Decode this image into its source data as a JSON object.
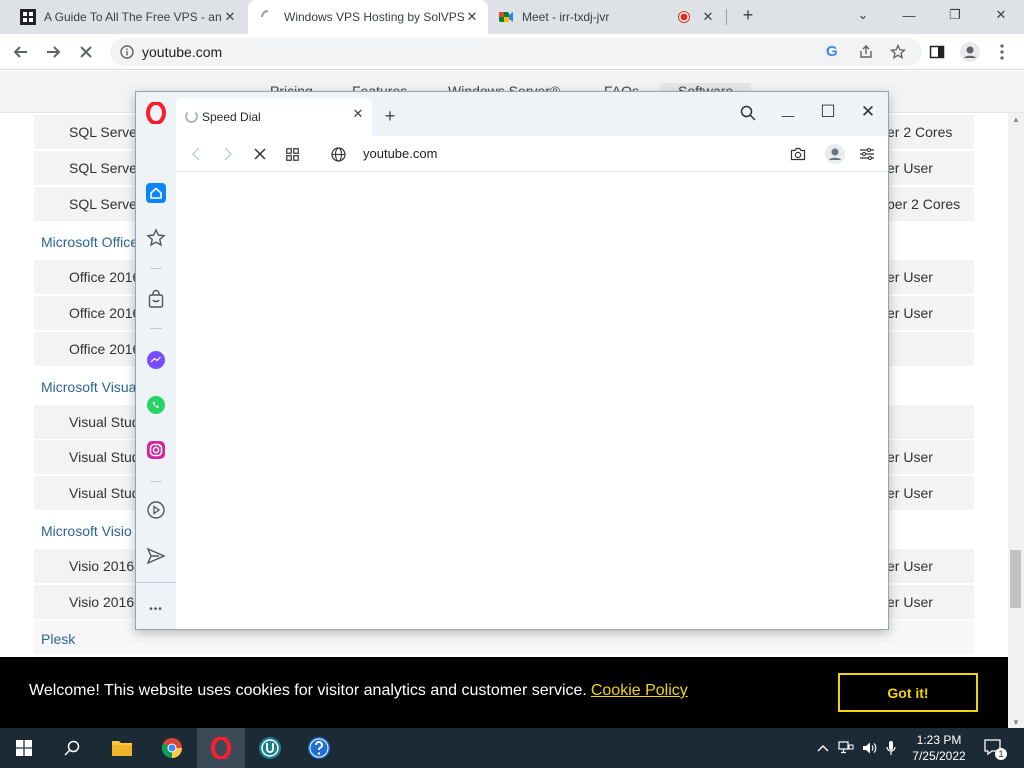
{
  "chrome": {
    "tabs": [
      {
        "title": "A Guide To All The Free VPS - an",
        "close": "✕"
      },
      {
        "title": "Windows VPS Hosting by SolVPS",
        "close": "✕"
      },
      {
        "title": "Meet - irr-txdj-jvr",
        "close": "✕"
      }
    ],
    "new_tab": "+",
    "url": "youtube.com",
    "window_buttons": {
      "dropdown": "⌄",
      "minimize": "—",
      "restore": "❐",
      "close": "✕"
    }
  },
  "site": {
    "nav": [
      "Pricing",
      "Features",
      "Windows Server®",
      "FAQs",
      "Software"
    ],
    "rows": [
      {
        "type": "row",
        "left": "SQL Serve",
        "right": "er 2 Cores"
      },
      {
        "type": "row",
        "left": "SQL Serve",
        "right": "er User"
      },
      {
        "type": "row",
        "left": "SQL Serve",
        "right": "per 2 Cores"
      },
      {
        "type": "cat",
        "label": "Microsoft Office"
      },
      {
        "type": "row",
        "left": "Office 2016",
        "right": "er User"
      },
      {
        "type": "row",
        "left": "Office 2016",
        "right": "er User"
      },
      {
        "type": "row",
        "left": "Office 2016",
        "right": ""
      },
      {
        "type": "cat",
        "label": "Microsoft Visua"
      },
      {
        "type": "row",
        "left": "Visual Stud",
        "right": ""
      },
      {
        "type": "row",
        "left": "Visual Stud",
        "right": "er User"
      },
      {
        "type": "row",
        "left": "Visual Stud",
        "right": "er User"
      },
      {
        "type": "cat",
        "label": "Microsoft Visio"
      },
      {
        "type": "row",
        "left": "Visio 2016",
        "right": "er User"
      },
      {
        "type": "row",
        "left": "Visio 2016",
        "right": "er User"
      },
      {
        "type": "cat",
        "label": "Plesk"
      }
    ],
    "cookie": {
      "message": "Welcome! This website uses cookies for visitor analytics and customer service.",
      "link": "Cookie Policy",
      "button": "Got it!"
    }
  },
  "opera": {
    "tab_title": "Speed Dial",
    "tab_close": "✕",
    "new_tab": "+",
    "url": "youtube.com",
    "sidebar_more": "•••",
    "window_buttons": {
      "minimize": "—",
      "maximize": "☐",
      "close": "✕"
    }
  },
  "taskbar": {
    "time": "1:23 PM",
    "date": "7/25/2022",
    "notification_count": "1"
  },
  "colors": {
    "opera_red": "#ff1b2d",
    "cookie_yellow": "#f1d600",
    "link_blue": "#2a6496",
    "taskbar": "#1c2a35"
  }
}
